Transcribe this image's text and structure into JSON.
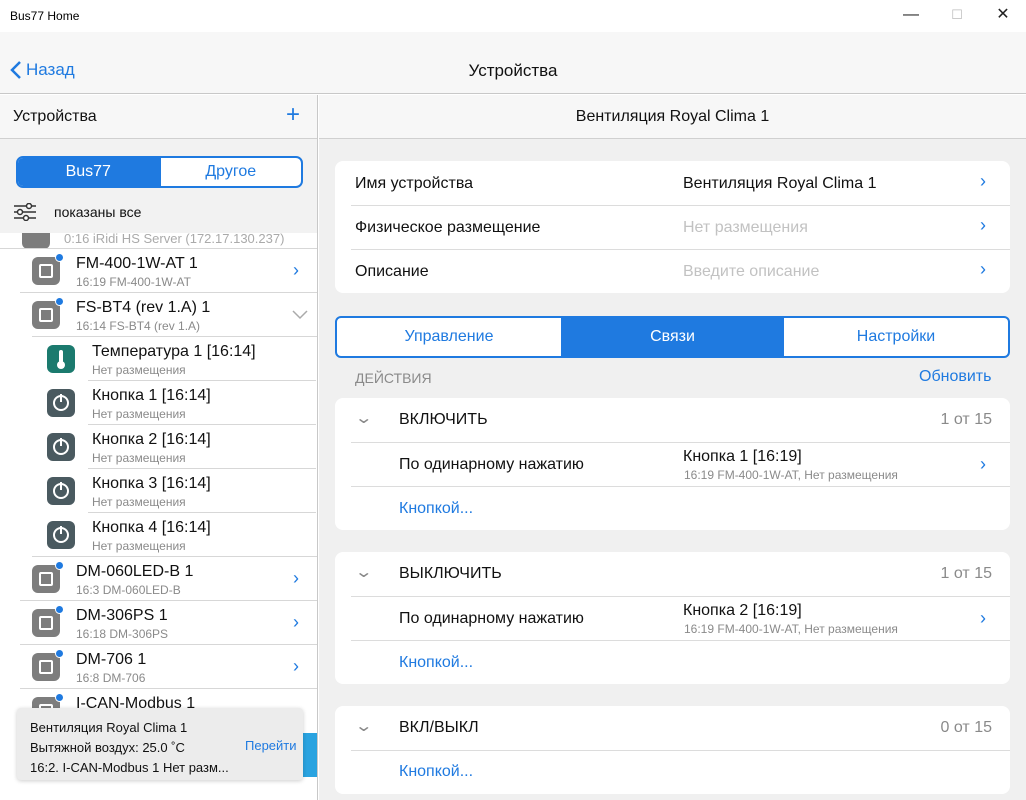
{
  "window": {
    "title": "Bus77 Home",
    "minimize": "—",
    "maximize": "☐",
    "close": "✕"
  },
  "nav": {
    "back": "Назад",
    "title": "Устройства"
  },
  "left": {
    "title": "Устройства",
    "add": "+",
    "segments": [
      "Bus77",
      "Другое"
    ],
    "filter": "показаны все",
    "partial_row": "0:16 iRidi HS Server (172.17.130.237)",
    "devices": [
      {
        "name": "FM-400-1W-AT 1",
        "sub": "16:19 FM-400-1W-AT"
      },
      {
        "name": "FS-BT4 (rev 1.A) 1",
        "sub": "16:14 FS-BT4 (rev 1.A)"
      }
    ],
    "sensors": [
      {
        "name": "Температура 1 [16:14]",
        "sub": "Нет размещения",
        "icon": "thermometer-icon"
      },
      {
        "name": "Кнопка 1 [16:14]",
        "sub": "Нет размещения",
        "icon": "power-icon"
      },
      {
        "name": "Кнопка 2 [16:14]",
        "sub": "Нет размещения",
        "icon": "power-icon"
      },
      {
        "name": "Кнопка 3 [16:14]",
        "sub": "Нет размещения",
        "icon": "power-icon"
      },
      {
        "name": "Кнопка 4 [16:14]",
        "sub": "Нет размещения",
        "icon": "power-icon"
      }
    ],
    "devices2": [
      {
        "name": "DM-060LED-B 1",
        "sub": "16:3 DM-060LED-B"
      },
      {
        "name": "DM-306PS 1",
        "sub": "16:18 DM-306PS"
      },
      {
        "name": "DM-706 1",
        "sub": "16:8 DM-706"
      },
      {
        "name": "I-CAN-Modbus 1",
        "sub": ""
      }
    ],
    "toast": {
      "line1": "Вентиляция Royal Clima 1",
      "line2": "Вытяжной воздух: 25.0 ˚С",
      "line3": "16:2. I-CAN-Modbus 1 Нет разм...",
      "action": "Перейти"
    }
  },
  "right": {
    "title": "Вентиляция Royal Clima 1",
    "props": [
      {
        "key": "Имя устройства",
        "value": "Вентиляция Royal Clima 1",
        "placeholder": false
      },
      {
        "key": "Физическое размещение",
        "value": "Нет размещения",
        "placeholder": true
      },
      {
        "key": "Описание",
        "value": "Введите описание",
        "placeholder": true
      }
    ],
    "tabs": [
      "Управление",
      "Связи",
      "Настройки"
    ],
    "actions_header": "ДЕЙСТВИЯ",
    "refresh": "Обновить",
    "actions": [
      {
        "name": "ВКЛЮЧИТЬ",
        "count": "1 от 15",
        "trigger": "По одинарному нажатию",
        "target": "Кнопка 1 [16:19]",
        "target_sub": "16:19 FM-400-1W-AT, Нет размещения",
        "link": "Кнопкой..."
      },
      {
        "name": "ВЫКЛЮЧИТЬ",
        "count": "1 от 15",
        "trigger": "По одинарному нажатию",
        "target": "Кнопка 2 [16:19]",
        "target_sub": "16:19 FM-400-1W-AT, Нет размещения",
        "link": "Кнопкой..."
      },
      {
        "name": "ВКЛ/ВЫКЛ",
        "count": "0 от 15",
        "link": "Кнопкой..."
      }
    ]
  },
  "colors": {
    "accent": "#1f7ae0",
    "sensor_green": "#1b7a6e",
    "device_gray": "#7d7d7d"
  }
}
